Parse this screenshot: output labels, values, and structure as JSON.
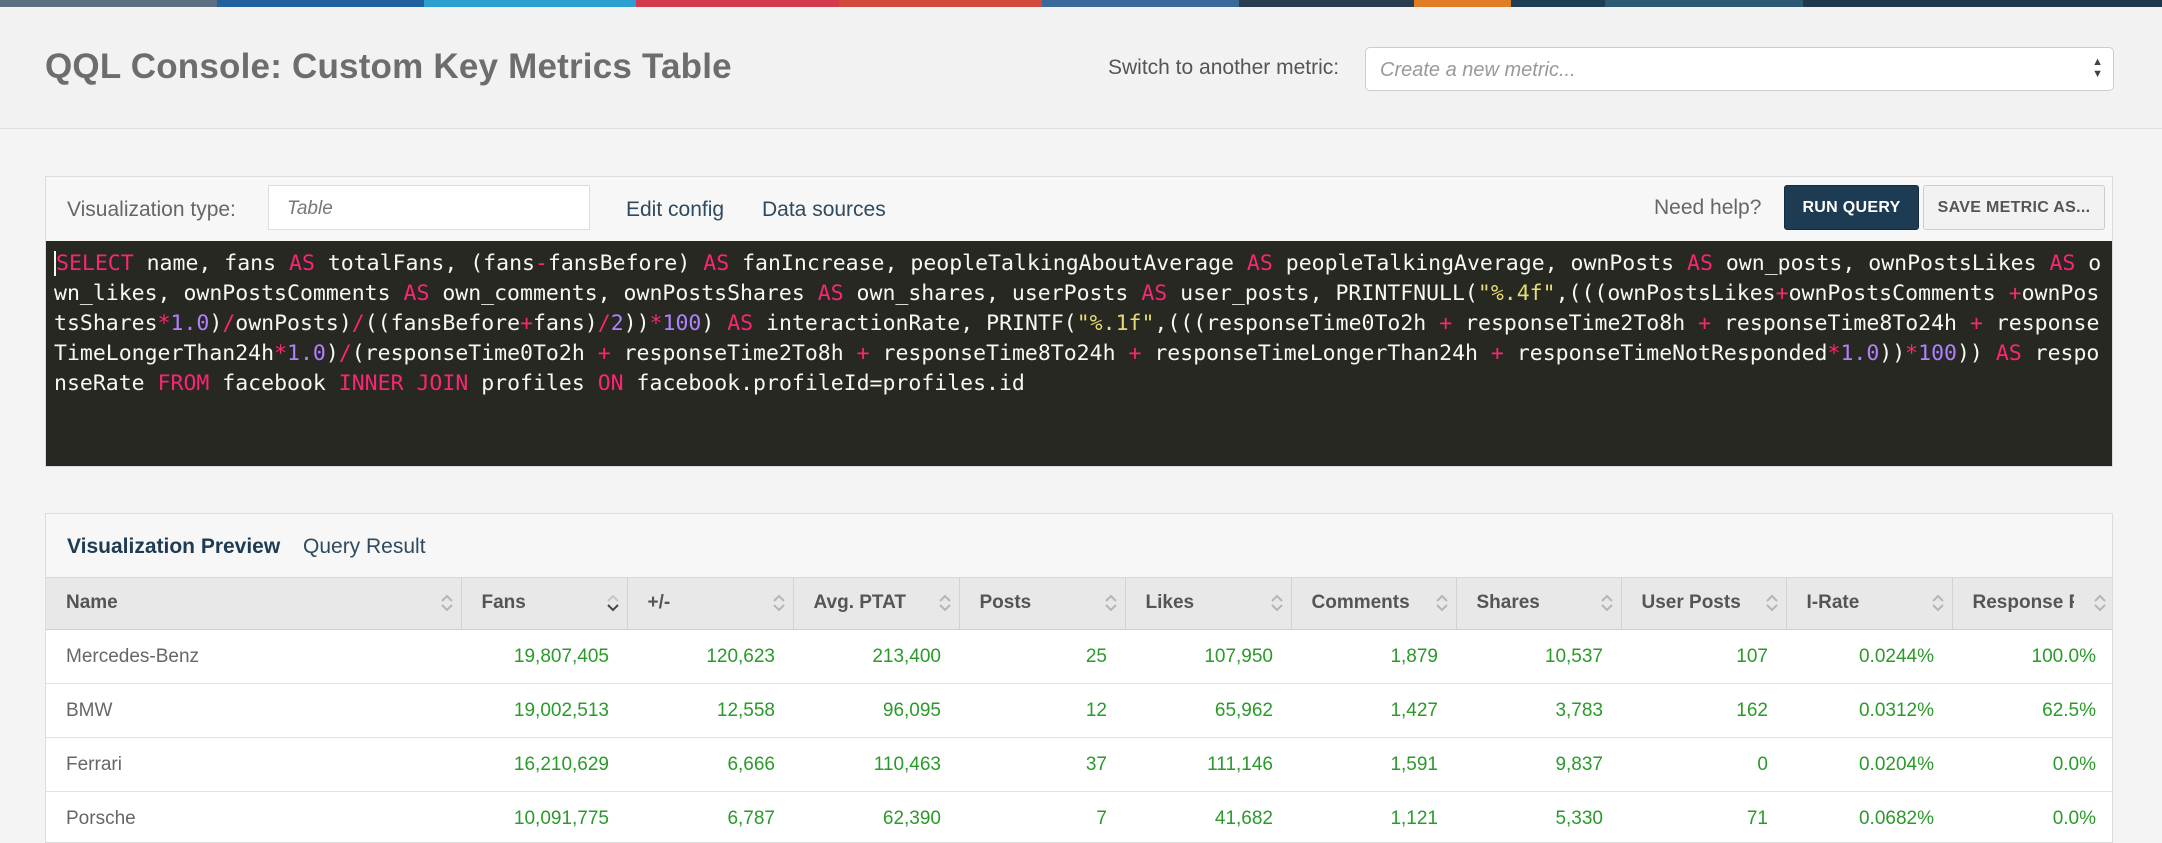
{
  "header": {
    "title": "QQL Console: Custom Key Metrics Table",
    "switch_label": "Switch to another metric:",
    "metric_placeholder": "Create a new metric..."
  },
  "stripe_colors": [
    "#5b6f80",
    "#23619e",
    "#2a9fd0",
    "#d43a4e",
    "#d14a3a",
    "#3a6a9a",
    "#2b3d50",
    "#e07b26",
    "#1c3d52",
    "#2d5a73",
    "#20384c"
  ],
  "toolbar": {
    "viz_label": "Visualization type:",
    "viz_placeholder": "Table",
    "edit_config": "Edit config",
    "data_sources": "Data sources",
    "need_help": "Need help?",
    "run_query": "RUN QUERY",
    "save_metric": "SAVE METRIC AS..."
  },
  "query": "SELECT name, fans AS totalFans, (fans-fansBefore) AS fanIncrease, peopleTalkingAboutAverage AS peopleTalkingAverage, ownPosts AS own_posts, ownPostsLikes AS own_likes, ownPostsComments AS own_comments, ownPostsShares AS own_shares, userPosts AS user_posts, PRINTFNULL(\"%.4f\",(((ownPostsLikes+ownPostsComments +ownPostsShares*1.0)/ownPosts)/((fansBefore+fans)/2))*100) AS interactionRate, PRINTF(\"%.1f\",(((responseTime0To2h + responseTime2To8h + responseTime8To24h + responseTimeLongerThan24h*1.0)/(responseTime0To2h + responseTime2To8h + responseTime8To24h + responseTimeLongerThan24h + responseTimeNotResponded*1.0))*100)) AS responseRate FROM facebook INNER JOIN profiles ON facebook.profileId=profiles.id",
  "results": {
    "tabs": [
      {
        "label": "Visualization Preview",
        "active": true
      },
      {
        "label": "Query Result",
        "active": false
      }
    ],
    "columns": [
      "Name",
      "Fans",
      "+/-",
      "Avg. PTAT",
      "Posts",
      "Likes",
      "Comments",
      "Shares",
      "User Posts",
      "I-Rate",
      "Response R..."
    ],
    "rows": [
      [
        "Mercedes-Benz",
        "19,807,405",
        "120,623",
        "213,400",
        "25",
        "107,950",
        "1,879",
        "10,537",
        "107",
        "0.0244%",
        "100.0%"
      ],
      [
        "BMW",
        "19,002,513",
        "12,558",
        "96,095",
        "12",
        "65,962",
        "1,427",
        "3,783",
        "162",
        "0.0312%",
        "62.5%"
      ],
      [
        "Ferrari",
        "16,210,629",
        "6,666",
        "110,463",
        "37",
        "111,146",
        "1,591",
        "9,837",
        "0",
        "0.0204%",
        "0.0%"
      ],
      [
        "Porsche",
        "10,091,775",
        "6,787",
        "62,390",
        "7",
        "41,682",
        "1,121",
        "5,330",
        "71",
        "0.0682%",
        "0.0%"
      ]
    ]
  }
}
